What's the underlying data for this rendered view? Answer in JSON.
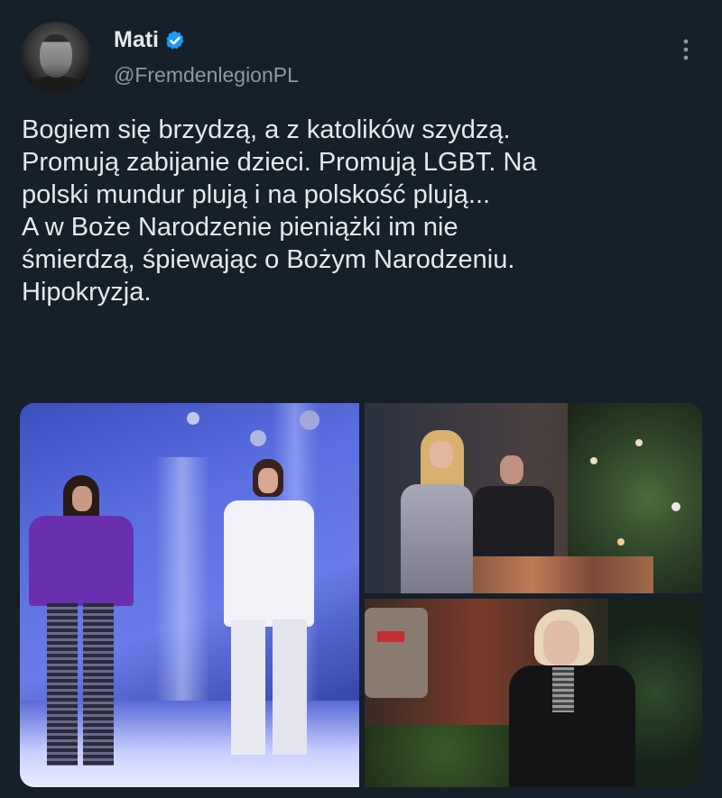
{
  "tweet": {
    "display_name": "Mati",
    "handle": "@FremdenlegionPL",
    "icons": {
      "avatar": "user-avatar-photo",
      "verified": "verified-badge-icon",
      "more": "more-options-icon"
    },
    "colors": {
      "background": "#15202b",
      "text": "#e7e9ea",
      "secondary_text": "#8b98a5",
      "verified_blue": "#1d9bf0"
    },
    "text_lines": [
      "Bogiem się brzydzą, a z katolików szydzą.",
      "Promują zabijanie dzieci. Promują LGBT. Na",
      "polski mundur plują i na polskość plują...",
      "A w Boże Narodzenie pieniążki im nie",
      "śmierdzą, śpiewając o Bożym Narodzeniu.",
      "Hipokryzja."
    ]
  }
}
